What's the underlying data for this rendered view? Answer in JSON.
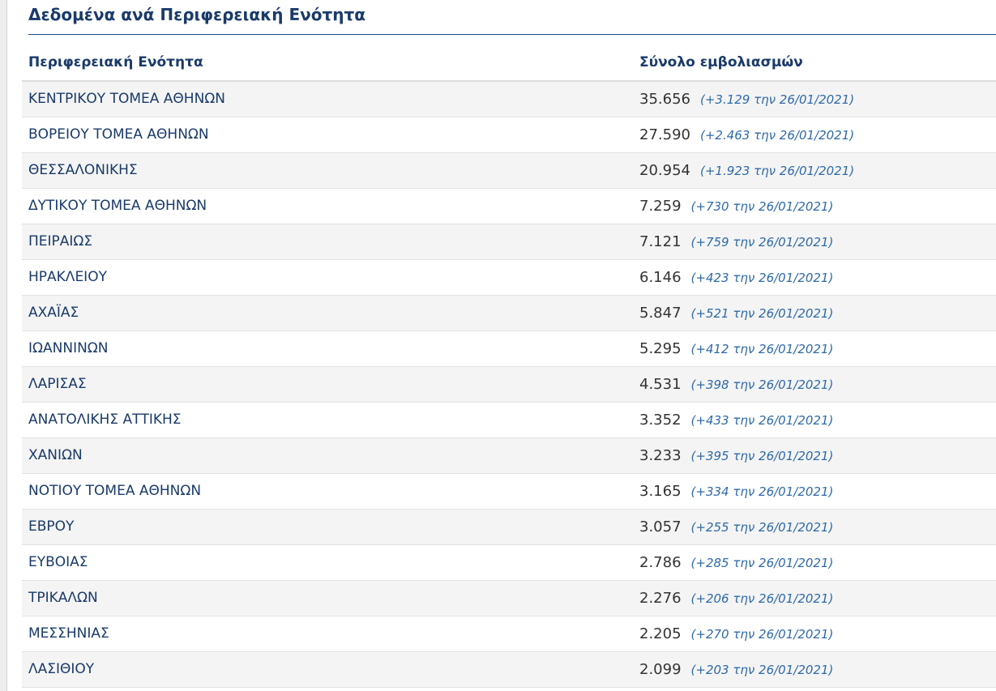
{
  "section": {
    "title": "Δεδομένα ανά Περιφερειακή Ενότητα"
  },
  "table": {
    "headers": [
      "Περιφερειακή Ενότητα",
      "Σύνολο εμβολιασμών"
    ],
    "rows": [
      {
        "region": "ΚΕΝΤΡΙΚΟΥ ΤΟΜΕΑ ΑΘΗΝΩΝ",
        "total": "35.656",
        "note": "(+3.129 την 26/01/2021)"
      },
      {
        "region": "ΒΟΡΕΙΟΥ ΤΟΜΕΑ ΑΘΗΝΩΝ",
        "total": "27.590",
        "note": "(+2.463 την 26/01/2021)"
      },
      {
        "region": "ΘΕΣΣΑΛΟΝΙΚΗΣ",
        "total": "20.954",
        "note": "(+1.923 την 26/01/2021)"
      },
      {
        "region": "ΔΥΤΙΚΟΥ ΤΟΜΕΑ ΑΘΗΝΩΝ",
        "total": "7.259",
        "note": "(+730 την 26/01/2021)"
      },
      {
        "region": "ΠΕΙΡΑΙΩΣ",
        "total": "7.121",
        "note": "(+759 την 26/01/2021)"
      },
      {
        "region": "ΗΡΑΚΛΕΙΟΥ",
        "total": "6.146",
        "note": "(+423 την 26/01/2021)"
      },
      {
        "region": "ΑΧΑΪΑΣ",
        "total": "5.847",
        "note": "(+521 την 26/01/2021)"
      },
      {
        "region": "ΙΩΑΝΝΙΝΩΝ",
        "total": "5.295",
        "note": "(+412 την 26/01/2021)"
      },
      {
        "region": "ΛΑΡΙΣΑΣ",
        "total": "4.531",
        "note": "(+398 την 26/01/2021)"
      },
      {
        "region": "ΑΝΑΤΟΛΙΚΗΣ ΑΤΤΙΚΗΣ",
        "total": "3.352",
        "note": "(+433 την 26/01/2021)"
      },
      {
        "region": "ΧΑΝΙΩΝ",
        "total": "3.233",
        "note": "(+395 την 26/01/2021)"
      },
      {
        "region": "ΝΟΤΙΟΥ ΤΟΜΕΑ ΑΘΗΝΩΝ",
        "total": "3.165",
        "note": "(+334 την 26/01/2021)"
      },
      {
        "region": "ΕΒΡΟΥ",
        "total": "3.057",
        "note": "(+255 την 26/01/2021)"
      },
      {
        "region": "ΕΥΒΟΙΑΣ",
        "total": "2.786",
        "note": "(+285 την 26/01/2021)"
      },
      {
        "region": "ΤΡΙΚΑΛΩΝ",
        "total": "2.276",
        "note": "(+206 την 26/01/2021)"
      },
      {
        "region": "ΜΕΣΣΗΝΙΑΣ",
        "total": "2.205",
        "note": "(+270 την 26/01/2021)"
      },
      {
        "region": "ΛΑΣΙΘΙΟΥ",
        "total": "2.099",
        "note": "(+203 την 26/01/2021)"
      }
    ]
  },
  "colors": {
    "heading": "#1a3a6b",
    "accent_note": "#2e6aa8",
    "row_stripe": "#f4f4f4"
  }
}
